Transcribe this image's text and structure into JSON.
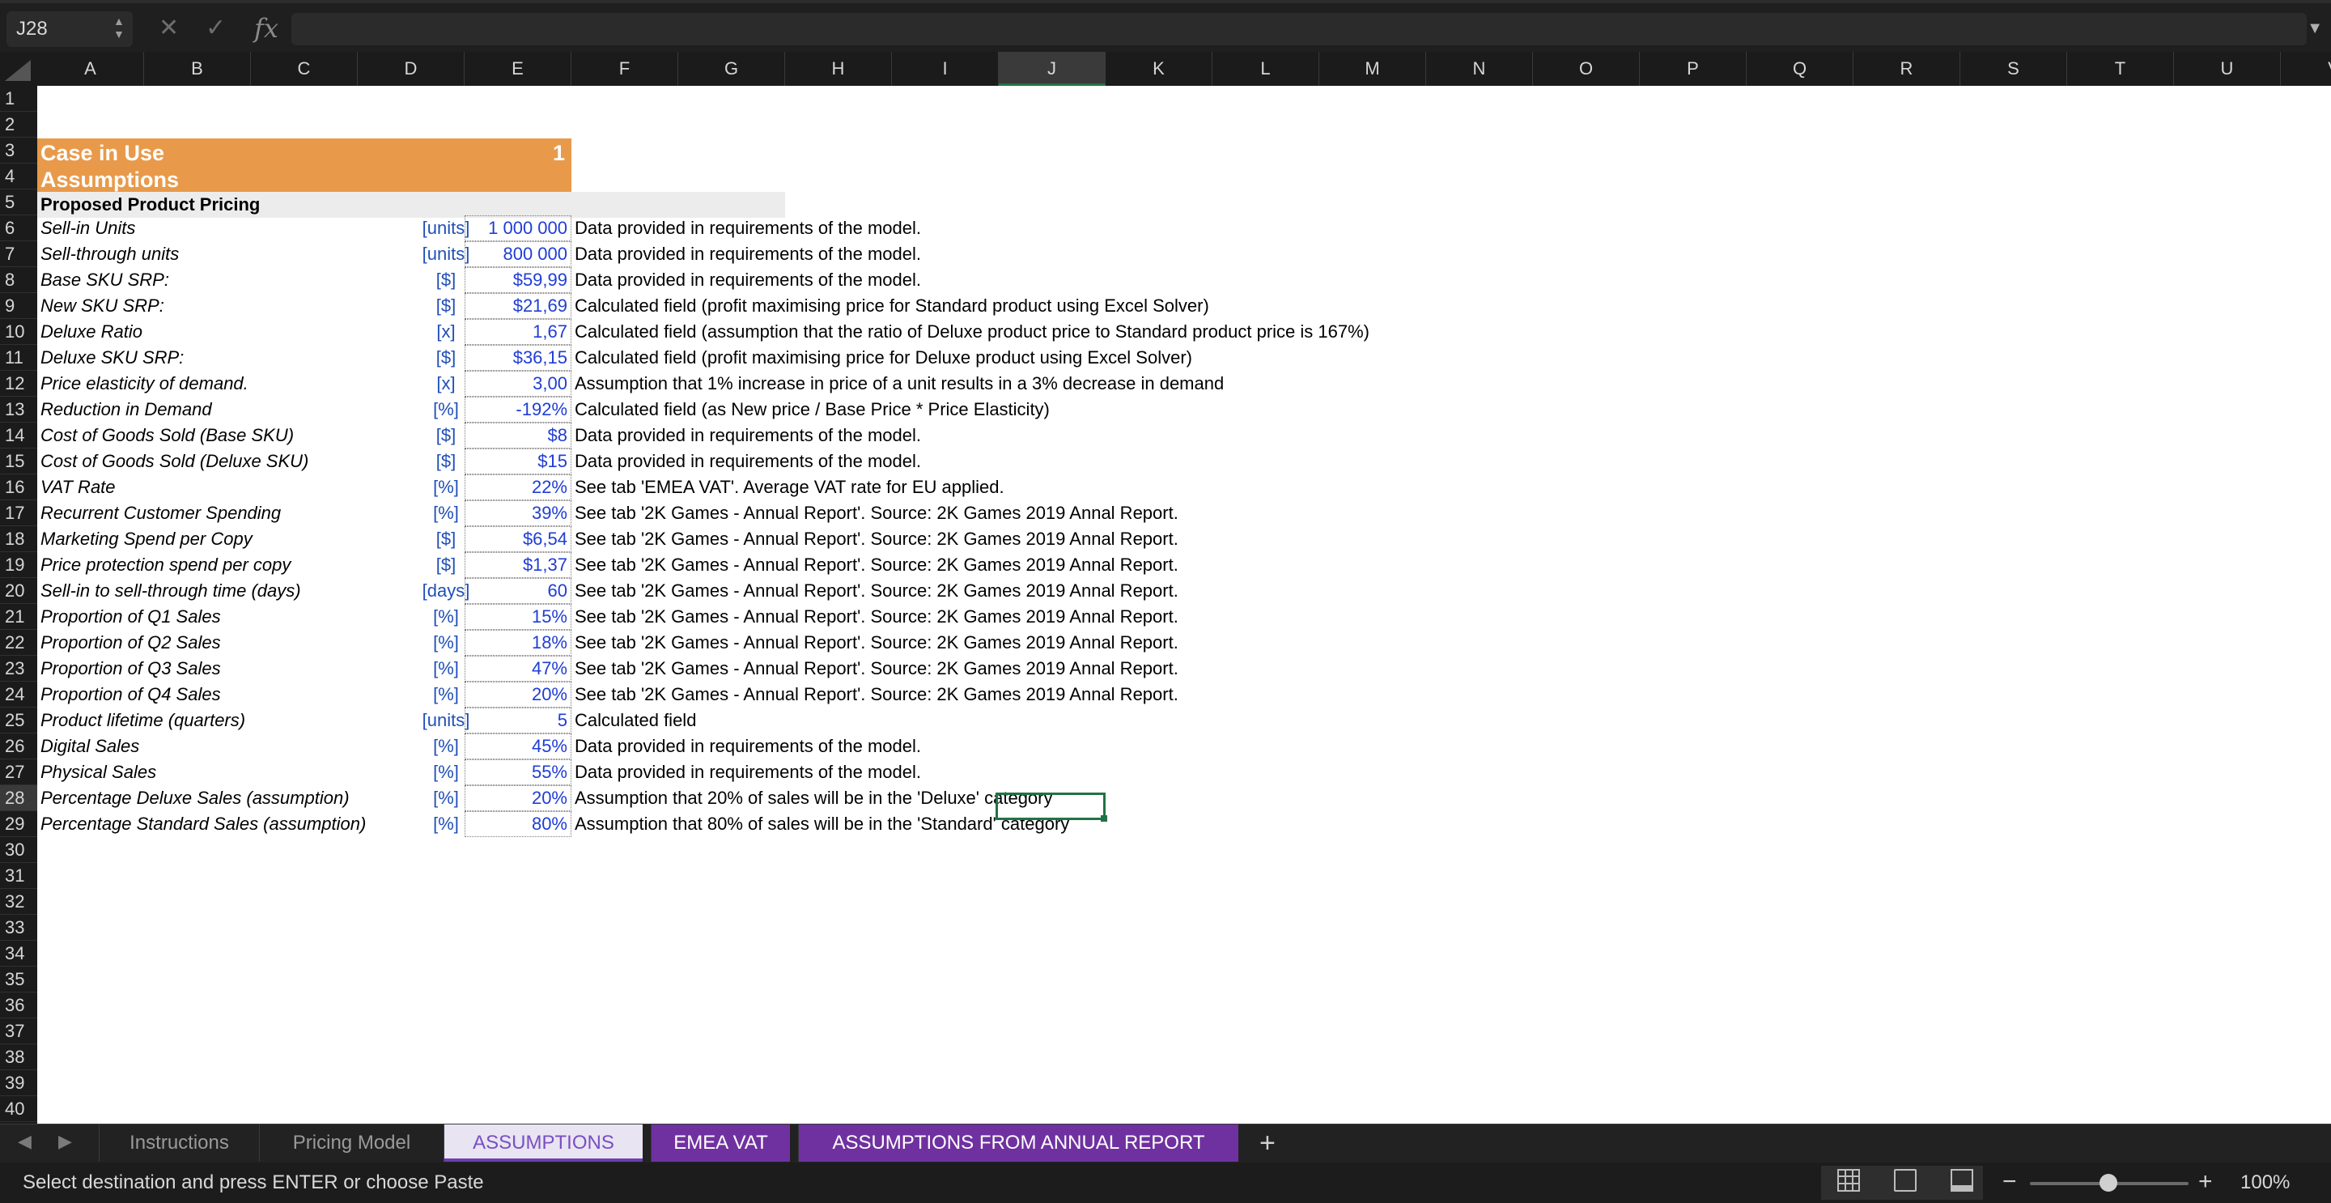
{
  "formula_bar": {
    "name_box": "J28",
    "cancel_glyph": "✕",
    "enter_glyph": "✓",
    "fx_label": "fx",
    "formula": ""
  },
  "columns": [
    "A",
    "B",
    "C",
    "D",
    "E",
    "F",
    "G",
    "H",
    "I",
    "J",
    "K",
    "L",
    "M",
    "N",
    "O",
    "P",
    "Q",
    "R",
    "S",
    "T",
    "U",
    "V"
  ],
  "active_column": "J",
  "rows": [
    "1",
    "2",
    "3",
    "4",
    "5",
    "6",
    "7",
    "8",
    "9",
    "10",
    "11",
    "12",
    "13",
    "14",
    "15",
    "16",
    "17",
    "18",
    "19",
    "20",
    "21",
    "22",
    "23",
    "24",
    "25",
    "26",
    "27",
    "28",
    "29",
    "30",
    "31",
    "32",
    "33",
    "34",
    "35",
    "36",
    "37",
    "38",
    "39",
    "40"
  ],
  "active_row": "28",
  "sheet": {
    "case_title": "Case in Use",
    "case_value": "1",
    "assumptions_title": "Assumptions",
    "section_title": "Proposed Product Pricing",
    "table": [
      {
        "param": "Sell-in Units",
        "unit": "[units]",
        "value": "1 000 000",
        "note": "Data provided in requirements of the model."
      },
      {
        "param": "Sell-through units",
        "unit": "[units]",
        "value": "800 000",
        "note": "Data provided in requirements of the model."
      },
      {
        "param": "Base SKU SRP:",
        "unit": "[$]",
        "value": "$59,99",
        "note": "Data provided in requirements of the model."
      },
      {
        "param": "New SKU SRP:",
        "unit": "[$]",
        "value": "$21,69",
        "note": "Calculated field (profit maximising price for Standard product using Excel Solver)"
      },
      {
        "param": "Deluxe Ratio",
        "unit": "[x]",
        "value": "1,67",
        "note": "Calculated field (assumption that the ratio of Deluxe product price to Standard product price is 167%)"
      },
      {
        "param": "Deluxe SKU SRP:",
        "unit": "[$]",
        "value": "$36,15",
        "note": "Calculated field (profit maximising price for Deluxe product using Excel Solver)"
      },
      {
        "param": "Price elasticity of demand.",
        "unit": "[x]",
        "value": "3,00",
        "note": "Assumption that 1% increase in price of a unit results in a 3% decrease in demand"
      },
      {
        "param": "Reduction in Demand",
        "unit": "[%]",
        "value": "-192%",
        "note": "Calculated field (as New price / Base Price * Price Elasticity)"
      },
      {
        "param": "Cost of Goods Sold (Base SKU)",
        "unit": "[$]",
        "value": "$8",
        "note": "Data provided in requirements of the model."
      },
      {
        "param": "Cost of Goods Sold (Deluxe SKU)",
        "unit": "[$]",
        "value": "$15",
        "note": "Data provided in requirements of the model."
      },
      {
        "param": "VAT Rate",
        "unit": "[%]",
        "value": "22%",
        "note": "See tab 'EMEA VAT'. Average VAT rate for EU applied."
      },
      {
        "param": "Recurrent Customer Spending",
        "unit": "[%]",
        "value": "39%",
        "note": "See tab '2K Games - Annual Report'. Source: 2K Games 2019 Annal Report."
      },
      {
        "param": "Marketing Spend per Copy",
        "unit": "[$]",
        "value": "$6,54",
        "note": "See tab '2K Games - Annual Report'. Source: 2K Games 2019 Annal Report."
      },
      {
        "param": "Price protection spend per copy",
        "unit": "[$]",
        "value": "$1,37",
        "note": "See tab '2K Games - Annual Report'. Source: 2K Games 2019 Annal Report."
      },
      {
        "param": "Sell-in to sell-through time (days)",
        "unit": "[days]",
        "value": "60",
        "note": "See tab '2K Games - Annual Report'. Source: 2K Games 2019 Annal Report."
      },
      {
        "param": "Proportion of Q1 Sales",
        "unit": "[%]",
        "value": "15%",
        "note": "See tab '2K Games - Annual Report'. Source: 2K Games 2019 Annal Report."
      },
      {
        "param": "Proportion of Q2 Sales",
        "unit": "[%]",
        "value": "18%",
        "note": "See tab '2K Games - Annual Report'. Source: 2K Games 2019 Annal Report."
      },
      {
        "param": "Proportion of Q3 Sales",
        "unit": "[%]",
        "value": "47%",
        "note": "See tab '2K Games - Annual Report'. Source: 2K Games 2019 Annal Report."
      },
      {
        "param": "Proportion of Q4 Sales",
        "unit": "[%]",
        "value": "20%",
        "note": "See tab '2K Games - Annual Report'. Source: 2K Games 2019 Annal Report."
      },
      {
        "param": "Product lifetime (quarters)",
        "unit": "[units]",
        "value": "5",
        "note": "Calculated field"
      },
      {
        "param": "Digital Sales",
        "unit": "[%]",
        "value": "45%",
        "note": "Data provided in requirements of the model."
      },
      {
        "param": "Physical Sales",
        "unit": "[%]",
        "value": "55%",
        "note": "Data provided in requirements of the model."
      },
      {
        "param": "Percentage Deluxe Sales (assumption)",
        "unit": "[%]",
        "value": "20%",
        "note": "Assumption that 20% of sales will be in the 'Deluxe' category"
      },
      {
        "param": "Percentage Standard Sales (assumption)",
        "unit": "[%]",
        "value": "80%",
        "note": "Assumption that 80% of sales will be in the 'Standard' category"
      }
    ]
  },
  "tabs": [
    {
      "label": "Instructions",
      "style": "normal"
    },
    {
      "label": "Pricing Model",
      "style": "normal"
    },
    {
      "label": "ASSUMPTIONS",
      "style": "active"
    },
    {
      "label": "EMEA VAT",
      "style": "purple"
    },
    {
      "label": "ASSUMPTIONS FROM ANNUAL REPORT",
      "style": "purple"
    }
  ],
  "add_sheet": "+",
  "status": {
    "message": "Select destination and press ENTER or choose Paste",
    "zoom": "100%",
    "zoom_minus": "−",
    "zoom_plus": "+"
  },
  "colors": {
    "title_band": "#e89a4a",
    "value_text": "#1f3dd6",
    "selection": "#217346",
    "tab_purple": "#7031a0"
  }
}
